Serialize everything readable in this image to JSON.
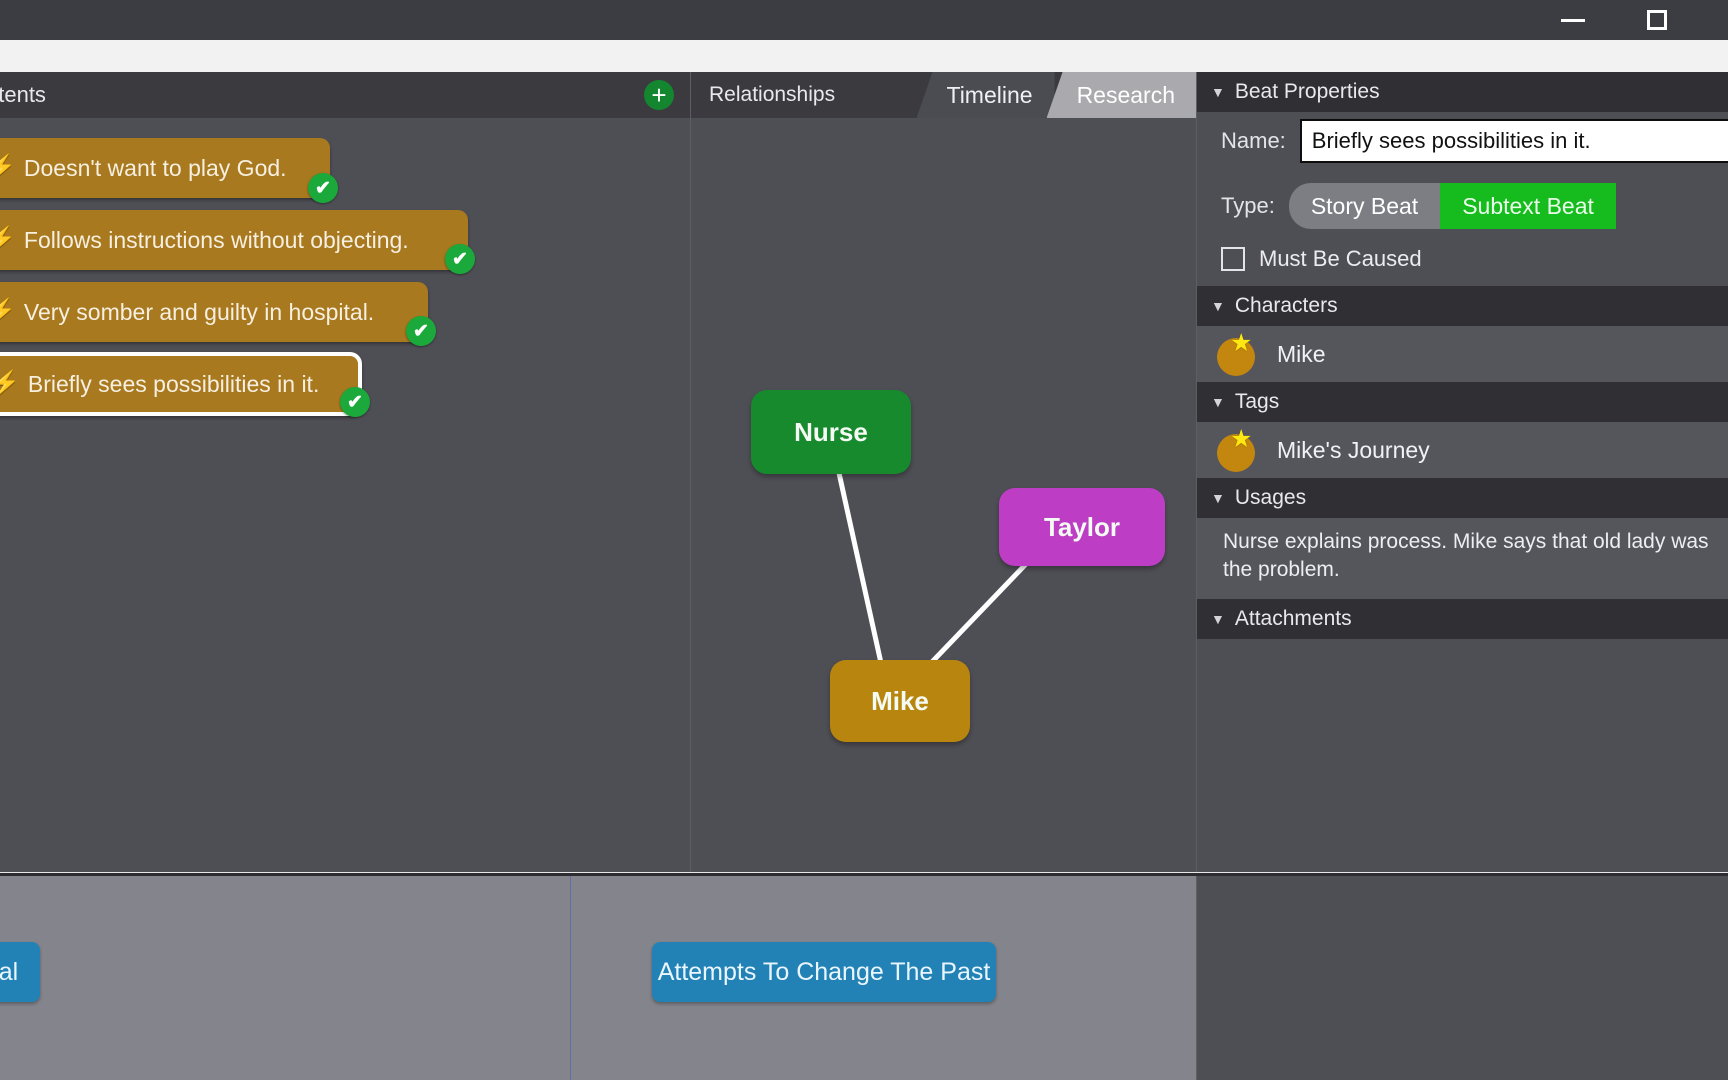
{
  "window": {
    "minimize_label": "minimize",
    "maximize_label": "maximize"
  },
  "contents_panel": {
    "title": "ntents",
    "full_title": "Contents",
    "add_button_label": "+",
    "beats": [
      {
        "text": "Doesn't want to play God.",
        "icon": "bolt-icon",
        "badge": "✔",
        "selected": false
      },
      {
        "text": "Follows instructions without objecting.",
        "icon": "bolt-icon",
        "badge": "✔",
        "selected": false
      },
      {
        "text": "Very somber and guilty in hospital.",
        "icon": "bolt-icon",
        "badge": "✔",
        "selected": false
      },
      {
        "text": "Briefly sees possibilities in it.",
        "icon": "bolt-icon",
        "badge": "✔",
        "selected": true
      }
    ]
  },
  "graph_panel": {
    "title": "Relationships",
    "tabs": [
      {
        "label": "Timeline",
        "active": false
      },
      {
        "label": "Research",
        "active": true
      }
    ],
    "nodes": [
      {
        "label": "Nurse",
        "color": "#168a2c"
      },
      {
        "label": "Taylor",
        "color": "#bd3ec4"
      },
      {
        "label": "Mike",
        "color": "#b8860f"
      }
    ],
    "edges": [
      {
        "from": "Nurse",
        "to": "Mike"
      },
      {
        "from": "Taylor",
        "to": "Mike"
      }
    ]
  },
  "properties_panel": {
    "header": "Beat Properties",
    "name_label": "Name:",
    "name_value": "Briefly sees possibilities in it.",
    "type_label": "Type:",
    "type_options": [
      {
        "label": "Story Beat",
        "selected": false
      },
      {
        "label": "Subtext Beat",
        "selected": true
      }
    ],
    "must_be_caused_label": "Must Be Caused",
    "must_be_caused_checked": false,
    "characters_header": "Characters",
    "characters": [
      {
        "name": "Mike",
        "avatar_color": "#c3860f",
        "starred": true
      }
    ],
    "tags_header": "Tags",
    "tags": [
      {
        "name": "Mike's Journey",
        "avatar_color": "#c3860f",
        "starred": true
      }
    ],
    "usages_header": "Usages",
    "usages_text": "Nurse explains process. Mike says that old lady was the problem.",
    "attachments_header": "Attachments"
  },
  "timeline": {
    "cards": [
      {
        "text": "tal",
        "full_text": "Hospital",
        "color": "#2282b5"
      },
      {
        "text": "Attempts To Change The Past",
        "color": "#2282b5"
      }
    ]
  },
  "colors": {
    "beat_card": "#a8791e",
    "check_badge": "#1aa93a",
    "accent_green": "#16bb1e",
    "panel_bg": "#4e4e55",
    "section_head": "#2f2f34",
    "timeline_bg": "#84848c"
  }
}
